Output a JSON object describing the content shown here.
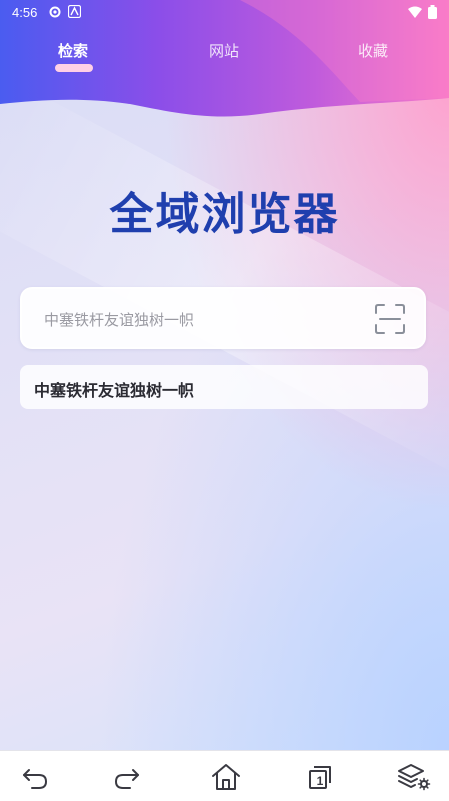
{
  "status_bar": {
    "time": "4:56",
    "icons_left": [
      "settings-gear-icon",
      "app-notification-icon"
    ],
    "icons_right": [
      "wifi-icon",
      "battery-icon"
    ]
  },
  "tabs": [
    {
      "label": "检索",
      "active": true
    },
    {
      "label": "网站",
      "active": false
    },
    {
      "label": "收藏",
      "active": false
    }
  ],
  "title": "全域浏览器",
  "search": {
    "placeholder": "中塞铁杆友谊独树一帜",
    "value": "",
    "scan_icon": "scan-icon"
  },
  "suggestion": {
    "text": "中塞铁杆友谊独树一帜"
  },
  "bottom_nav": [
    {
      "name": "back-icon"
    },
    {
      "name": "forward-icon"
    },
    {
      "name": "home-icon"
    },
    {
      "name": "tabs-icon",
      "count": "1"
    },
    {
      "name": "layers-settings-icon"
    }
  ],
  "colors": {
    "header_start": "#4a5cf0",
    "header_mid": "#a048e6",
    "header_end": "#f36fc6",
    "title": "#1f3fae",
    "tab_indicator": "#ffd0e6"
  }
}
